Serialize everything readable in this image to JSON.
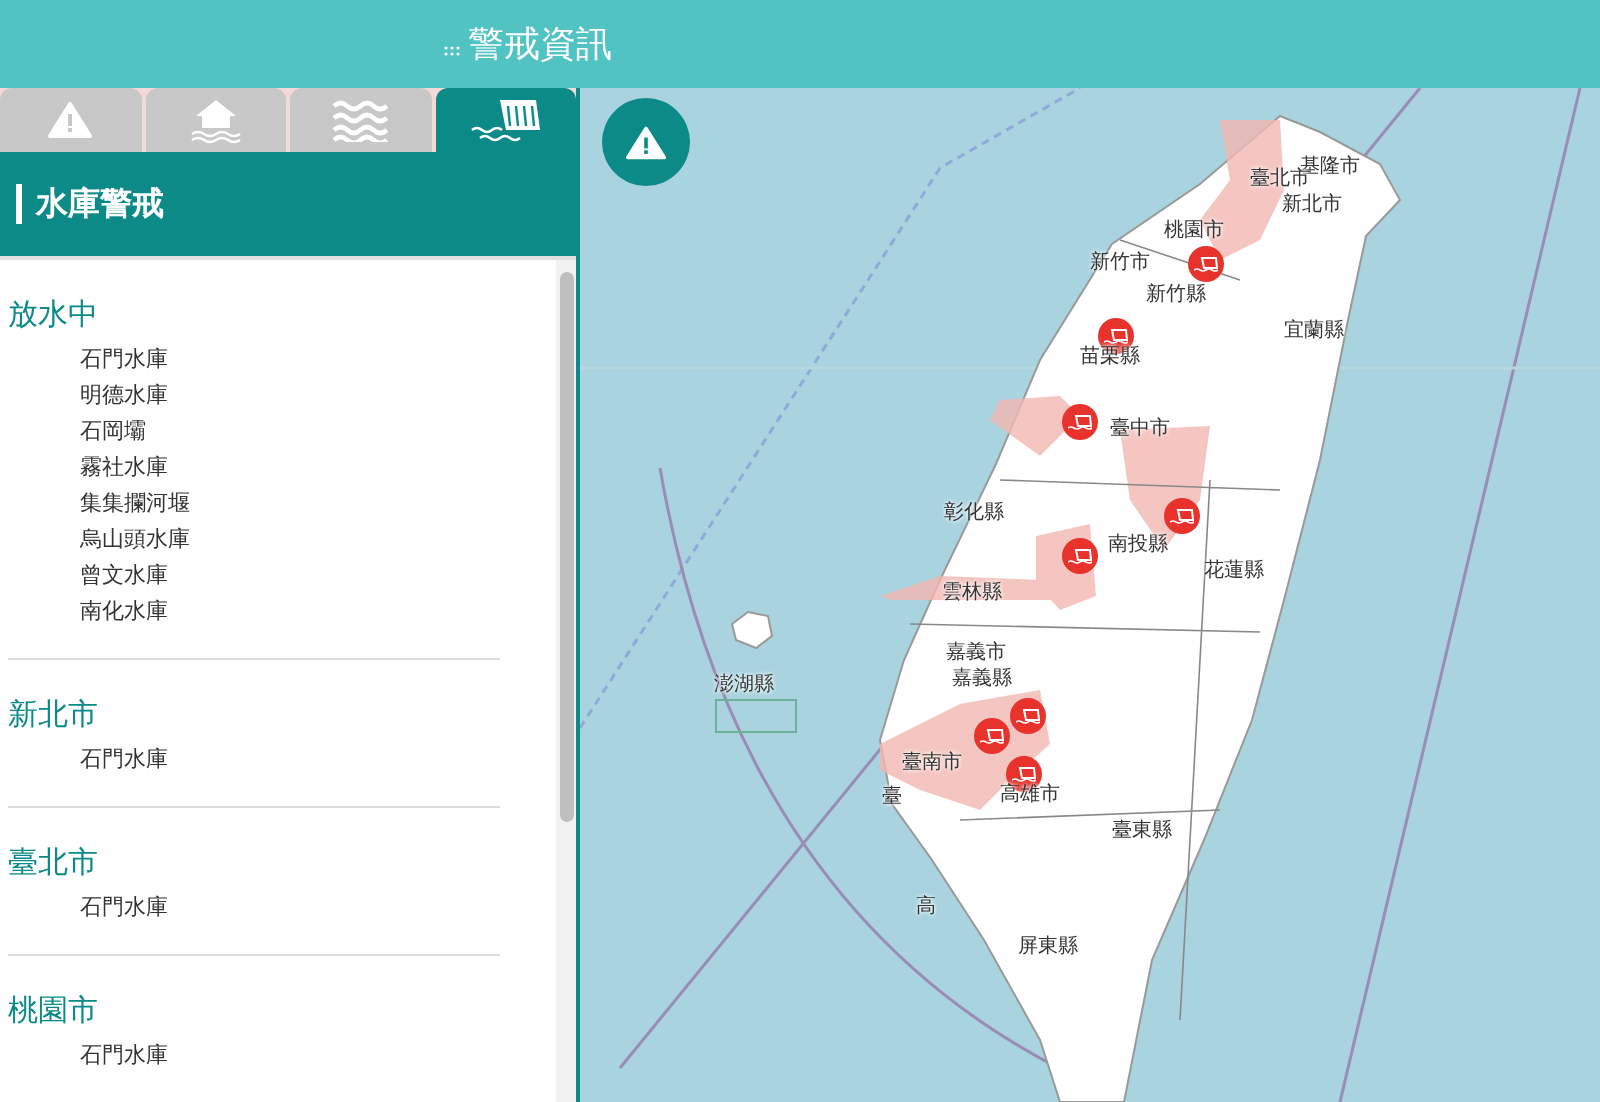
{
  "header": {
    "title": "警戒資訊"
  },
  "tabs": [
    {
      "kind": "warning",
      "selected": false
    },
    {
      "kind": "flood",
      "selected": false
    },
    {
      "kind": "waves",
      "selected": false
    },
    {
      "kind": "dam",
      "selected": true
    }
  ],
  "panel": {
    "title": "水庫警戒",
    "groups": [
      {
        "name": "放水中",
        "items": [
          "石門水庫",
          "明德水庫",
          "石岡壩",
          "霧社水庫",
          "集集攔河堰",
          "烏山頭水庫",
          "曾文水庫",
          "南化水庫"
        ]
      },
      {
        "name": "新北市",
        "items": [
          "石門水庫"
        ]
      },
      {
        "name": "臺北市",
        "items": [
          "石門水庫"
        ]
      },
      {
        "name": "桃園市",
        "items": [
          "石門水庫"
        ]
      }
    ]
  },
  "map": {
    "labels": [
      "基隆市",
      "臺北市",
      "新北市",
      "桃園市",
      "新竹市",
      "新竹縣",
      "宜蘭縣",
      "苗栗縣",
      "臺中市",
      "彰化縣",
      "南投縣",
      "花蓮縣",
      "雲林縣",
      "嘉義市",
      "嘉義縣",
      "澎湖縣",
      "臺南市",
      "高雄市",
      "臺東縣",
      "屏東縣",
      "臺",
      "高"
    ]
  }
}
